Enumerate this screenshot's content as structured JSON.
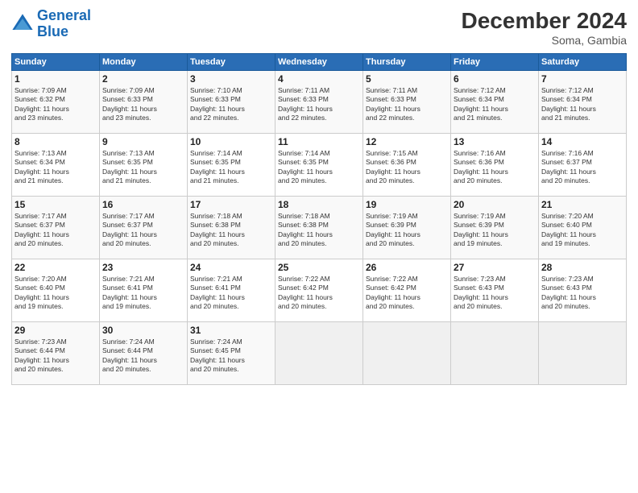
{
  "header": {
    "logo_line1": "General",
    "logo_line2": "Blue",
    "title": "December 2024",
    "location": "Soma, Gambia"
  },
  "weekdays": [
    "Sunday",
    "Monday",
    "Tuesday",
    "Wednesday",
    "Thursday",
    "Friday",
    "Saturday"
  ],
  "weeks": [
    [
      {
        "day": "1",
        "info": "Sunrise: 7:09 AM\nSunset: 6:32 PM\nDaylight: 11 hours\nand 23 minutes."
      },
      {
        "day": "2",
        "info": "Sunrise: 7:09 AM\nSunset: 6:33 PM\nDaylight: 11 hours\nand 23 minutes."
      },
      {
        "day": "3",
        "info": "Sunrise: 7:10 AM\nSunset: 6:33 PM\nDaylight: 11 hours\nand 22 minutes."
      },
      {
        "day": "4",
        "info": "Sunrise: 7:11 AM\nSunset: 6:33 PM\nDaylight: 11 hours\nand 22 minutes."
      },
      {
        "day": "5",
        "info": "Sunrise: 7:11 AM\nSunset: 6:33 PM\nDaylight: 11 hours\nand 22 minutes."
      },
      {
        "day": "6",
        "info": "Sunrise: 7:12 AM\nSunset: 6:34 PM\nDaylight: 11 hours\nand 21 minutes."
      },
      {
        "day": "7",
        "info": "Sunrise: 7:12 AM\nSunset: 6:34 PM\nDaylight: 11 hours\nand 21 minutes."
      }
    ],
    [
      {
        "day": "8",
        "info": "Sunrise: 7:13 AM\nSunset: 6:34 PM\nDaylight: 11 hours\nand 21 minutes."
      },
      {
        "day": "9",
        "info": "Sunrise: 7:13 AM\nSunset: 6:35 PM\nDaylight: 11 hours\nand 21 minutes."
      },
      {
        "day": "10",
        "info": "Sunrise: 7:14 AM\nSunset: 6:35 PM\nDaylight: 11 hours\nand 21 minutes."
      },
      {
        "day": "11",
        "info": "Sunrise: 7:14 AM\nSunset: 6:35 PM\nDaylight: 11 hours\nand 20 minutes."
      },
      {
        "day": "12",
        "info": "Sunrise: 7:15 AM\nSunset: 6:36 PM\nDaylight: 11 hours\nand 20 minutes."
      },
      {
        "day": "13",
        "info": "Sunrise: 7:16 AM\nSunset: 6:36 PM\nDaylight: 11 hours\nand 20 minutes."
      },
      {
        "day": "14",
        "info": "Sunrise: 7:16 AM\nSunset: 6:37 PM\nDaylight: 11 hours\nand 20 minutes."
      }
    ],
    [
      {
        "day": "15",
        "info": "Sunrise: 7:17 AM\nSunset: 6:37 PM\nDaylight: 11 hours\nand 20 minutes."
      },
      {
        "day": "16",
        "info": "Sunrise: 7:17 AM\nSunset: 6:37 PM\nDaylight: 11 hours\nand 20 minutes."
      },
      {
        "day": "17",
        "info": "Sunrise: 7:18 AM\nSunset: 6:38 PM\nDaylight: 11 hours\nand 20 minutes."
      },
      {
        "day": "18",
        "info": "Sunrise: 7:18 AM\nSunset: 6:38 PM\nDaylight: 11 hours\nand 20 minutes."
      },
      {
        "day": "19",
        "info": "Sunrise: 7:19 AM\nSunset: 6:39 PM\nDaylight: 11 hours\nand 20 minutes."
      },
      {
        "day": "20",
        "info": "Sunrise: 7:19 AM\nSunset: 6:39 PM\nDaylight: 11 hours\nand 19 minutes."
      },
      {
        "day": "21",
        "info": "Sunrise: 7:20 AM\nSunset: 6:40 PM\nDaylight: 11 hours\nand 19 minutes."
      }
    ],
    [
      {
        "day": "22",
        "info": "Sunrise: 7:20 AM\nSunset: 6:40 PM\nDaylight: 11 hours\nand 19 minutes."
      },
      {
        "day": "23",
        "info": "Sunrise: 7:21 AM\nSunset: 6:41 PM\nDaylight: 11 hours\nand 19 minutes."
      },
      {
        "day": "24",
        "info": "Sunrise: 7:21 AM\nSunset: 6:41 PM\nDaylight: 11 hours\nand 20 minutes."
      },
      {
        "day": "25",
        "info": "Sunrise: 7:22 AM\nSunset: 6:42 PM\nDaylight: 11 hours\nand 20 minutes."
      },
      {
        "day": "26",
        "info": "Sunrise: 7:22 AM\nSunset: 6:42 PM\nDaylight: 11 hours\nand 20 minutes."
      },
      {
        "day": "27",
        "info": "Sunrise: 7:23 AM\nSunset: 6:43 PM\nDaylight: 11 hours\nand 20 minutes."
      },
      {
        "day": "28",
        "info": "Sunrise: 7:23 AM\nSunset: 6:43 PM\nDaylight: 11 hours\nand 20 minutes."
      }
    ],
    [
      {
        "day": "29",
        "info": "Sunrise: 7:23 AM\nSunset: 6:44 PM\nDaylight: 11 hours\nand 20 minutes."
      },
      {
        "day": "30",
        "info": "Sunrise: 7:24 AM\nSunset: 6:44 PM\nDaylight: 11 hours\nand 20 minutes."
      },
      {
        "day": "31",
        "info": "Sunrise: 7:24 AM\nSunset: 6:45 PM\nDaylight: 11 hours\nand 20 minutes."
      },
      {
        "day": "",
        "info": ""
      },
      {
        "day": "",
        "info": ""
      },
      {
        "day": "",
        "info": ""
      },
      {
        "day": "",
        "info": ""
      }
    ]
  ]
}
